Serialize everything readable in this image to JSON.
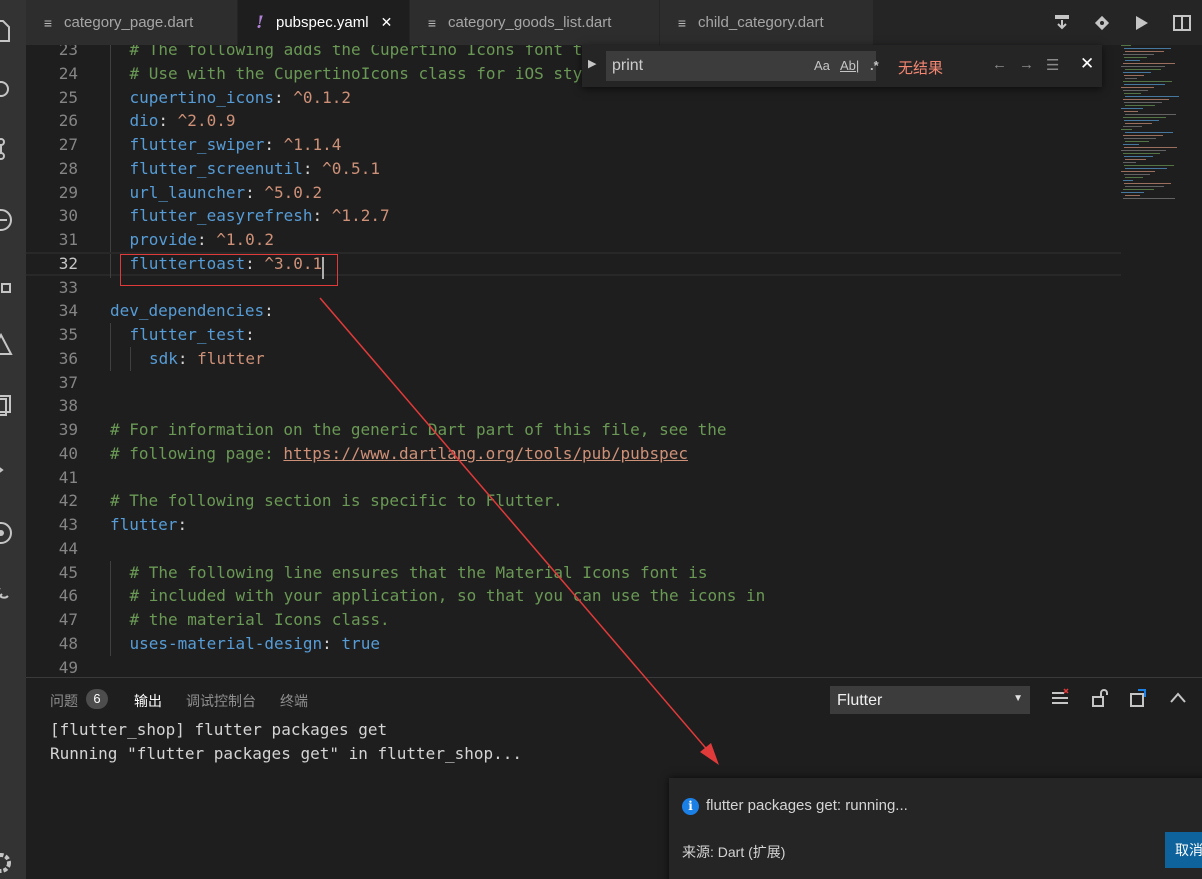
{
  "tabs": [
    {
      "label": "category_page.dart",
      "icon": "lines-icon"
    },
    {
      "label": "pubspec.yaml",
      "icon": "exclamation-icon",
      "active": true
    },
    {
      "label": "category_goods_list.dart",
      "icon": "lines-icon"
    },
    {
      "label": "child_category.dart",
      "icon": "lines-icon"
    }
  ],
  "code": {
    "lines": [
      {
        "n": "23",
        "indent": 1,
        "parts": [
          {
            "t": "# The following adds the Cupertino Icons font t",
            "c": "c-cmt"
          }
        ]
      },
      {
        "n": "24",
        "indent": 1,
        "parts": [
          {
            "t": "# Use with the CupertinoIcons class for iOS sty",
            "c": "c-cmt"
          }
        ]
      },
      {
        "n": "25",
        "indent": 1,
        "parts": [
          {
            "t": "cupertino_icons",
            "c": "c-key"
          },
          {
            "t": ": ",
            "c": "c-punc"
          },
          {
            "t": "^0.1.2",
            "c": "c-str"
          }
        ]
      },
      {
        "n": "26",
        "indent": 1,
        "parts": [
          {
            "t": "dio",
            "c": "c-key"
          },
          {
            "t": ": ",
            "c": "c-punc"
          },
          {
            "t": "^2.0.9",
            "c": "c-str"
          }
        ]
      },
      {
        "n": "27",
        "indent": 1,
        "parts": [
          {
            "t": "flutter_swiper",
            "c": "c-key"
          },
          {
            "t": ": ",
            "c": "c-punc"
          },
          {
            "t": "^1.1.4",
            "c": "c-str"
          }
        ]
      },
      {
        "n": "28",
        "indent": 1,
        "parts": [
          {
            "t": "flutter_screenutil",
            "c": "c-key"
          },
          {
            "t": ": ",
            "c": "c-punc"
          },
          {
            "t": "^0.5.1",
            "c": "c-str"
          }
        ]
      },
      {
        "n": "29",
        "indent": 1,
        "parts": [
          {
            "t": "url_launcher",
            "c": "c-key"
          },
          {
            "t": ": ",
            "c": "c-punc"
          },
          {
            "t": "^5.0.2",
            "c": "c-str"
          }
        ]
      },
      {
        "n": "30",
        "indent": 1,
        "parts": [
          {
            "t": "flutter_easyrefresh",
            "c": "c-key"
          },
          {
            "t": ": ",
            "c": "c-punc"
          },
          {
            "t": "^1.2.7",
            "c": "c-str"
          }
        ]
      },
      {
        "n": "31",
        "indent": 1,
        "parts": [
          {
            "t": "provide",
            "c": "c-key"
          },
          {
            "t": ": ",
            "c": "c-punc"
          },
          {
            "t": "^1.0.2",
            "c": "c-str"
          }
        ]
      },
      {
        "n": "32",
        "indent": 1,
        "current": true,
        "parts": [
          {
            "t": "fluttertoast",
            "c": "c-key"
          },
          {
            "t": ": ",
            "c": "c-punc"
          },
          {
            "t": "^3.0.1",
            "c": "c-str"
          }
        ]
      },
      {
        "n": "33",
        "indent": 0,
        "parts": []
      },
      {
        "n": "34",
        "indent": 0,
        "parts": [
          {
            "t": "dev_dependencies",
            "c": "c-key"
          },
          {
            "t": ":",
            "c": "c-punc"
          }
        ]
      },
      {
        "n": "35",
        "indent": 1,
        "parts": [
          {
            "t": "flutter_test",
            "c": "c-key"
          },
          {
            "t": ":",
            "c": "c-punc"
          }
        ]
      },
      {
        "n": "36",
        "indent": 2,
        "parts": [
          {
            "t": "sdk",
            "c": "c-key"
          },
          {
            "t": ": ",
            "c": "c-punc"
          },
          {
            "t": "flutter",
            "c": "c-str"
          }
        ]
      },
      {
        "n": "37",
        "indent": 0,
        "parts": []
      },
      {
        "n": "38",
        "indent": 0,
        "parts": []
      },
      {
        "n": "39",
        "indent": 0,
        "parts": [
          {
            "t": "# For information on the generic Dart part of this file, see the",
            "c": "c-cmt"
          }
        ]
      },
      {
        "n": "40",
        "indent": 0,
        "parts": [
          {
            "t": "# following page: ",
            "c": "c-cmt"
          },
          {
            "t": "https://www.dartlang.org/tools/pub/pubspec",
            "c": "c-link"
          }
        ]
      },
      {
        "n": "41",
        "indent": 0,
        "parts": []
      },
      {
        "n": "42",
        "indent": 0,
        "parts": [
          {
            "t": "# The following section is specific to Flutter.",
            "c": "c-cmt"
          }
        ]
      },
      {
        "n": "43",
        "indent": 0,
        "parts": [
          {
            "t": "flutter",
            "c": "c-key"
          },
          {
            "t": ":",
            "c": "c-punc"
          }
        ]
      },
      {
        "n": "44",
        "indent": 0,
        "parts": []
      },
      {
        "n": "45",
        "indent": 1,
        "parts": [
          {
            "t": "# The following line ensures that the Material Icons font is",
            "c": "c-cmt"
          }
        ]
      },
      {
        "n": "46",
        "indent": 1,
        "parts": [
          {
            "t": "# included with your application, so that you can use the icons in",
            "c": "c-cmt"
          }
        ]
      },
      {
        "n": "47",
        "indent": 1,
        "parts": [
          {
            "t": "# the material Icons class.",
            "c": "c-cmt"
          }
        ]
      },
      {
        "n": "48",
        "indent": 1,
        "parts": [
          {
            "t": "uses-material-design",
            "c": "c-key"
          },
          {
            "t": ": ",
            "c": "c-punc"
          },
          {
            "t": "true",
            "c": "c-key"
          }
        ]
      },
      {
        "n": "49",
        "indent": 0,
        "parts": []
      }
    ]
  },
  "find": {
    "query": "print",
    "match_case": "Aa",
    "whole_word": "Ab|",
    "regex": ".*",
    "status": "无结果"
  },
  "panel": {
    "tabs": [
      {
        "label": "问题",
        "count": "6"
      },
      {
        "label": "输出",
        "active": true
      },
      {
        "label": "调试控制台"
      },
      {
        "label": "终端"
      }
    ],
    "channel": "Flutter",
    "output": [
      "[flutter_shop] flutter packages get",
      "Running \"flutter packages get\" in flutter_shop..."
    ]
  },
  "notification": {
    "message": "flutter packages get: running...",
    "source": "来源: Dart (扩展)",
    "cancel_label": "取消"
  },
  "colors": {
    "annotation": "#e13a3a",
    "accent": "#0e639c",
    "info": "#1b80e6"
  }
}
